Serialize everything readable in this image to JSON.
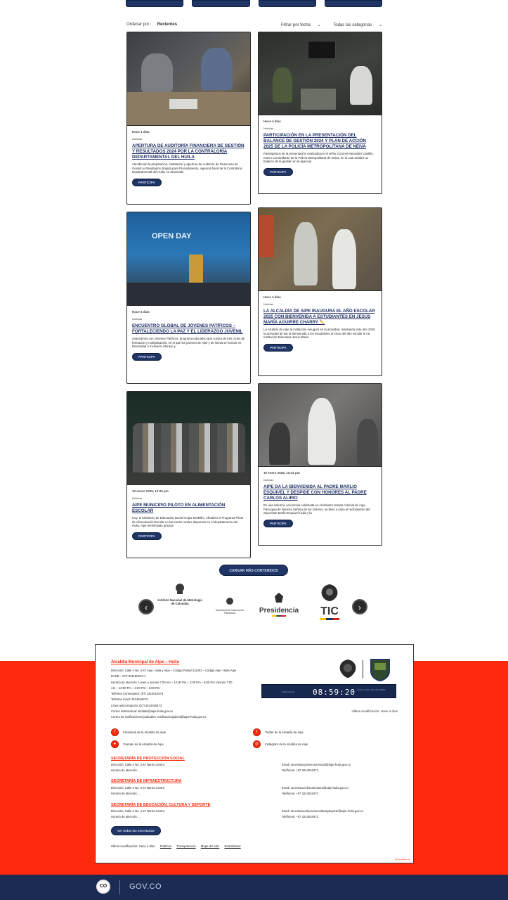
{
  "sortbar": {
    "order_label": "Ordenar por:",
    "order_value": "Recientes",
    "filter_label": "Filtrar por fecha",
    "filter_value": "Todas las categorías"
  },
  "cards": [
    {
      "date": "Hace 4 días",
      "category": "Noticias",
      "title": "APERTURA DE AUDITORÍA FINANCIERA DE GESTIÓN Y RESULTADOS 2024 POR LA CONTRALORÍA DEPARTAMENTAL DEL HUILA",
      "desc": "Atendiendo la preparación, instalación y apertura de Auditoría de Financiera de Gestión y Resultados dirigida para Procedimiento, vigencia fiscal de la Contraloría Departamental del Huila; en desarrollo",
      "button": "PARTICIPA"
    },
    {
      "date": "Hace 4 días",
      "category": "Noticias",
      "title": "PARTICIPACIÓN EN LA PRESENTACIÓN DEL BALANCE DE GESTIÓN 2024 Y PLAN DE ACCIÓN 2025 DE LA POLICÍA METROPOLITANA DE NEIVA",
      "desc": "Participamos de la presentación realizada por el señor Coronel Alexander Castillo, nuevo Comandante de la Policía Metropolitana de Neiva, en la cual analizó un balance de la gestión en la vigencia",
      "button": "PARTICIPA"
    },
    {
      "date": "Hace 4 días",
      "category": "Noticias",
      "title": "ENCUENTRO GLOBAL DE JÓVENES PATÍFICOS – FORTALECIENDO LA PAZ Y EL LIDERAZGO JUVENIL",
      "desc": "Avanzamos con Jóvenes Patíficos, programa educativo que consta de tres ciclos de formación y multiplicación, en el que los jóvenes de Aipe y de Neiva se forman en Diversidad e Inclusión, Manejo y",
      "button": "PARTICIPA"
    },
    {
      "date": "Hace 4 días",
      "category": "Noticias",
      "title": "LA ALCALDÍA DE AIPE INAUGURA EL AÑO ESCOLAR 2025 CON BIENVENIDA A ESTUDIANTES EN JESÚS MARÍA AGUIRRE CHARRY ✏️",
      "desc": "La Alcaldía de Aipe la institución inauguró en la actividad, realizando este año 2025 la actividad de dar la bienvenida a los estudiantes al inicio del año escolar en la Institución Educativa Jesús María",
      "button": "PARTICIPA"
    },
    {
      "date": "10 enero 2025, 12:00 pm",
      "category": "Noticias",
      "title": "AIPE MUNICIPIO PILOTO EN ALIMENTACIÓN ESCOLAR",
      "desc": "Hoy, el Ministerio de Educación Daniel Rojas Medellín, oficializó el Programa Piloto de Alimentación Escolar en las zonas rurales dispersas en el departamento del Huila, Aipe beneficiado gracias",
      "button": "PARTICIPA"
    },
    {
      "date": "10 enero 2025, 10:41 pm",
      "category": "Noticias",
      "title": "AIPE DA LA BIENVENIDA AL PADRE MARLIO ESQUIVEL Y DESPIDE CON HONORES AL PADRE CARLOS ALIRIO",
      "desc": "En una solemne ceremonia celebrada en el Ministro templo colonial de Aipe, Parroquia de Nuestra Señora de los Dolores, se llevó a cabo el recibimiento del Sacerdote Marlio Esquivel Huila y la",
      "button": "PARTICIPA"
    }
  ],
  "load_more": "CARGAR MÁS CONTENIDOS",
  "carousel": {
    "prev": "‹",
    "next": "›",
    "logos": [
      {
        "name": "Instituto Nacional de Metrología de Colombia",
        "icon": "seal-icon"
      },
      {
        "name": "Departamento Nacional de Planeación",
        "icon": "seal-icon"
      },
      {
        "name": "Presidencia",
        "icon": "seal-icon"
      },
      {
        "name": "TIC",
        "icon": "seal-icon"
      }
    ]
  },
  "footer": {
    "title": "Alcaldía Municipal de Aipe – Huila",
    "lines": [
      "Dirección: Calle 4 No. 4-47 Aipe, Huila y Aipe – Código Postal 411001 – Código Aipe: Huila-Aipe",
      "DANE – NIT: 891180043-1",
      "Horario de atención: Lunes a Jueves 7:00 Am – 12:00 Pm – 2:00 Pm – 6:00 Pm Viernes 7:00",
      "Am – 12:00 Pm – 2:00 Pm – 5:00 Pm",
      "Teléfono Conmutador: (57) 3214016473",
      "Teléfono móvil: 3214016473",
      "Línea anticorrupción: (57) 3214016473",
      "Correo institucional: alcaldia@aipe-huila.gov.co",
      "Correo de notificaciones judiciales: notificacionjudicial@aipe-huila.gov.co"
    ],
    "clock_time": "08:59:20",
    "clock_left": "HORA LEGAL",
    "clock_right": "HORA LEGAL DE COLOMBIA",
    "updated": "Última modificación: Hace 4 días",
    "social": [
      {
        "label": "Facebook de la Alcaldía de Aipe",
        "icon": "facebook-icon",
        "glyph": "f"
      },
      {
        "label": "Twitter de la Alcaldía de Aipe",
        "icon": "twitter-icon",
        "glyph": "t"
      },
      {
        "label": "Youtube de la Alcaldía de Aipe",
        "icon": "youtube-icon",
        "glyph": "▸"
      },
      {
        "label": "Instagram de la Alcaldía de Aipe",
        "icon": "instagram-icon",
        "glyph": "◎"
      }
    ],
    "sections": [
      {
        "title": "SECRETARÍA DE PROTECCIÓN SOCIAL",
        "address": "Dirección: Calle 4 No. 4-47 Barrio Centro",
        "hours": "Horario de atención: ...",
        "email": "Email: secretaria.proteccionsocial@aipe-huila.gov.co",
        "phone": "Teléfonos: +57 3214016473"
      },
      {
        "title": "SECRETARÍA DE INFRAESTRUCTURA",
        "address": "Dirección: Calle 4 No. 4-47 Barrio Centro",
        "hours": "Horario de atención: ...",
        "email": "Email: secretaria.infraestructura@aipe-huila.gov.co",
        "phone": "Teléfonos: +57 3214016473"
      },
      {
        "title": "SECRETARÍA DE EDUCACIÓN, CULTURA Y DEPORTE",
        "address": "Dirección: Calle 4 No. 4-47 Barrio Centro",
        "hours": "Horario de atención: ...",
        "email": "Email: secretaria.educacionculturaydeporte@aipe-huila.gov.co",
        "phone": "Teléfonos: +57 3214016473"
      }
    ],
    "all_button": "Ver todas las secretarías",
    "bottom_prefix": "Última modificación: Hace 4 días",
    "bottom_links": [
      "Políticas",
      "Transparencia",
      "Mapa del sitio",
      "Estadísticas"
    ],
    "tiny": "Desarrollado por"
  },
  "govbar": {
    "co": "CO",
    "gov": "GOV.CO"
  },
  "colors": {
    "accent_red": "#ff2a0e",
    "navy": "#1f3566",
    "gov_bar": "#1c2b52"
  }
}
